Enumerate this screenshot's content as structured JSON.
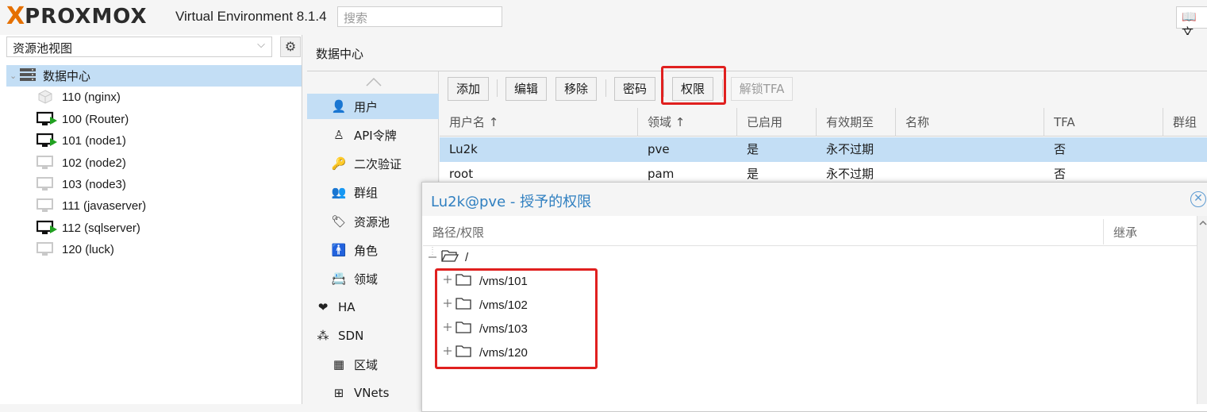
{
  "header": {
    "logo_text_pre": "X",
    "logo_text": "PROXMOX",
    "version": "Virtual Environment 8.1.4",
    "search_placeholder": "搜索",
    "docs_label": "文"
  },
  "sidebar": {
    "view_selected": "资源池视图",
    "tree_root": "数据中心",
    "items": [
      {
        "label": "110 (nginx)",
        "icon": "container-icon"
      },
      {
        "label": "100 (Router)",
        "icon": "vm-running-icon"
      },
      {
        "label": "101 (node1)",
        "icon": "vm-running-icon"
      },
      {
        "label": "102 (node2)",
        "icon": "vm-stopped-icon"
      },
      {
        "label": "103 (node3)",
        "icon": "vm-stopped-icon"
      },
      {
        "label": "111 (javaserver)",
        "icon": "vm-stopped-icon"
      },
      {
        "label": "112 (sqlserver)",
        "icon": "vm-running-icon"
      },
      {
        "label": "120 (luck)",
        "icon": "vm-stopped-icon"
      }
    ]
  },
  "content": {
    "title": "数据中心",
    "menu": [
      {
        "label": "用户",
        "icon": "user-icon",
        "selected": true
      },
      {
        "label": "API令牌",
        "icon": "user-outline-icon"
      },
      {
        "label": "二次验证",
        "icon": "key-icon"
      },
      {
        "label": "群组",
        "icon": "users-icon"
      },
      {
        "label": "资源池",
        "icon": "tags-icon"
      },
      {
        "label": "角色",
        "icon": "person-icon"
      },
      {
        "label": "领域",
        "icon": "address-book-icon"
      },
      {
        "label": "HA",
        "icon": "heartbeat-icon"
      },
      {
        "label": "SDN",
        "icon": "sdn-icon"
      },
      {
        "label": "区域",
        "icon": "grid-icon"
      },
      {
        "label": "VNets",
        "icon": "sitemap-icon"
      }
    ],
    "toolbar": {
      "add": "添加",
      "edit": "编辑",
      "remove": "移除",
      "password": "密码",
      "permissions": "权限",
      "unlock_tfa": "解锁TFA"
    },
    "grid": {
      "columns": [
        "用户名 ↑",
        "领域 ↑",
        "已启用",
        "有效期至",
        "名称",
        "TFA",
        "群组"
      ],
      "rows": [
        {
          "username": "Lu2k",
          "realm": "pve",
          "enabled": "是",
          "expire": "永不过期",
          "name": "",
          "tfa": "否",
          "groups": ""
        },
        {
          "username": "root",
          "realm": "pam",
          "enabled": "是",
          "expire": "永不过期",
          "name": "",
          "tfa": "否",
          "groups": ""
        }
      ]
    }
  },
  "permissions_window": {
    "title_user": "Lu2k@pve",
    "title_suffix": " - 授予的权限",
    "columns": [
      "路径/权限",
      "继承"
    ],
    "root_path": "/",
    "paths": [
      "/vms/101",
      "/vms/102",
      "/vms/103",
      "/vms/120"
    ]
  }
}
